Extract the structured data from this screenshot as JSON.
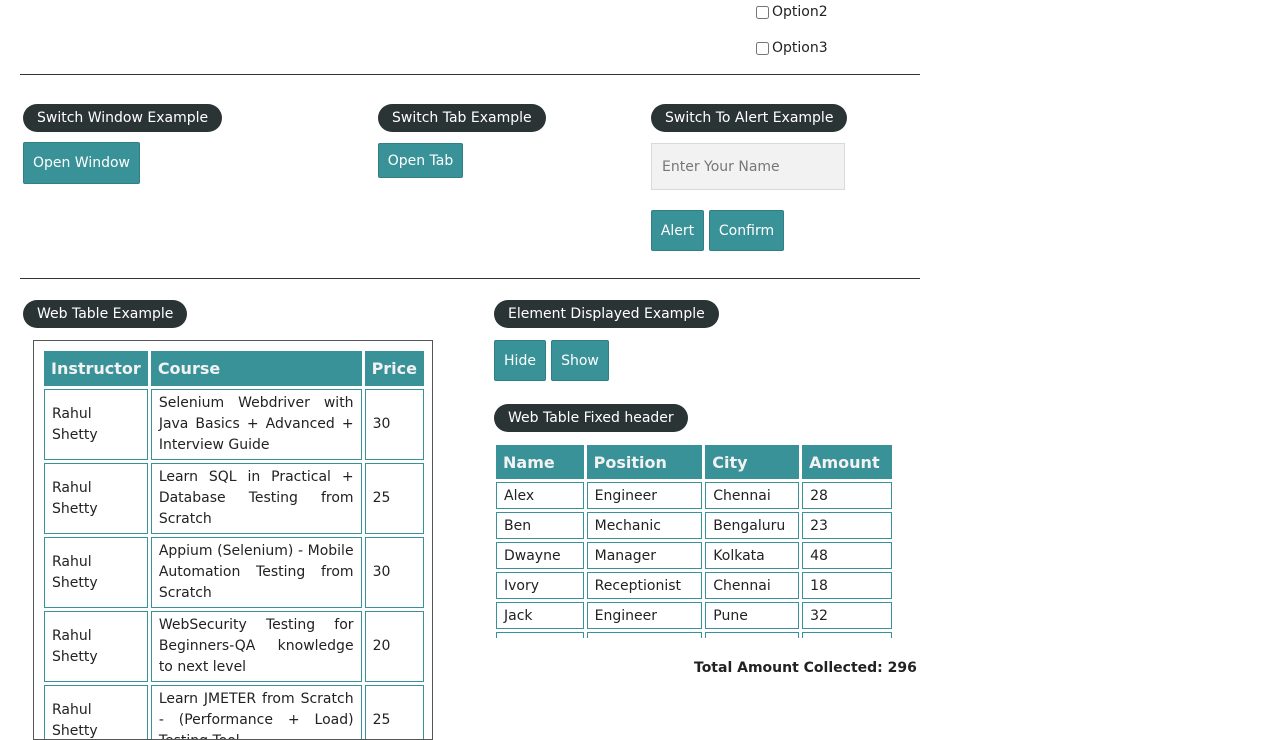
{
  "checkboxes": {
    "option2": "Option2",
    "option3": "Option3"
  },
  "switch_window": {
    "legend": "Switch Window Example",
    "button": "Open Window"
  },
  "switch_tab": {
    "legend": "Switch Tab Example",
    "button": "Open Tab"
  },
  "alert": {
    "legend": "Switch To Alert Example",
    "placeholder": "Enter Your Name",
    "alert_button": "Alert",
    "confirm_button": "Confirm"
  },
  "web_table": {
    "legend": "Web Table Example",
    "headers": [
      "Instructor",
      "Course",
      "Price"
    ],
    "rows": [
      {
        "instructor": "Rahul Shetty",
        "course": "Selenium Webdriver with Java Basics + Advanced + Interview Guide",
        "price": "30"
      },
      {
        "instructor": "Rahul Shetty",
        "course": "Learn SQL in Practical + Database Testing from Scratch",
        "price": "25"
      },
      {
        "instructor": "Rahul Shetty",
        "course": "Appium (Selenium) - Mobile Automation Testing from Scratch",
        "price": "30"
      },
      {
        "instructor": "Rahul Shetty",
        "course": "WebSecurity Testing for Beginners-QA knowledge to next level",
        "price": "20"
      },
      {
        "instructor": "Rahul Shetty",
        "course": "Learn JMETER from Scratch - (Performance + Load) Testing Tool",
        "price": "25"
      }
    ]
  },
  "element_displayed": {
    "legend": "Element Displayed Example",
    "hide": "Hide",
    "show": "Show"
  },
  "fixed_table": {
    "legend": "Web Table Fixed header",
    "headers": [
      "Name",
      "Position",
      "City",
      "Amount"
    ],
    "rows": [
      {
        "name": "Alex",
        "position": "Engineer",
        "city": "Chennai",
        "amount": "28"
      },
      {
        "name": "Ben",
        "position": "Mechanic",
        "city": "Bengaluru",
        "amount": "23"
      },
      {
        "name": "Dwayne",
        "position": "Manager",
        "city": "Kolkata",
        "amount": "48"
      },
      {
        "name": "Ivory",
        "position": "Receptionist",
        "city": "Chennai",
        "amount": "18"
      },
      {
        "name": "Jack",
        "position": "Engineer",
        "city": "Pune",
        "amount": "32"
      },
      {
        "name": "",
        "position": "",
        "city": "",
        "amount": ""
      }
    ],
    "total": "Total Amount Collected: 296"
  }
}
